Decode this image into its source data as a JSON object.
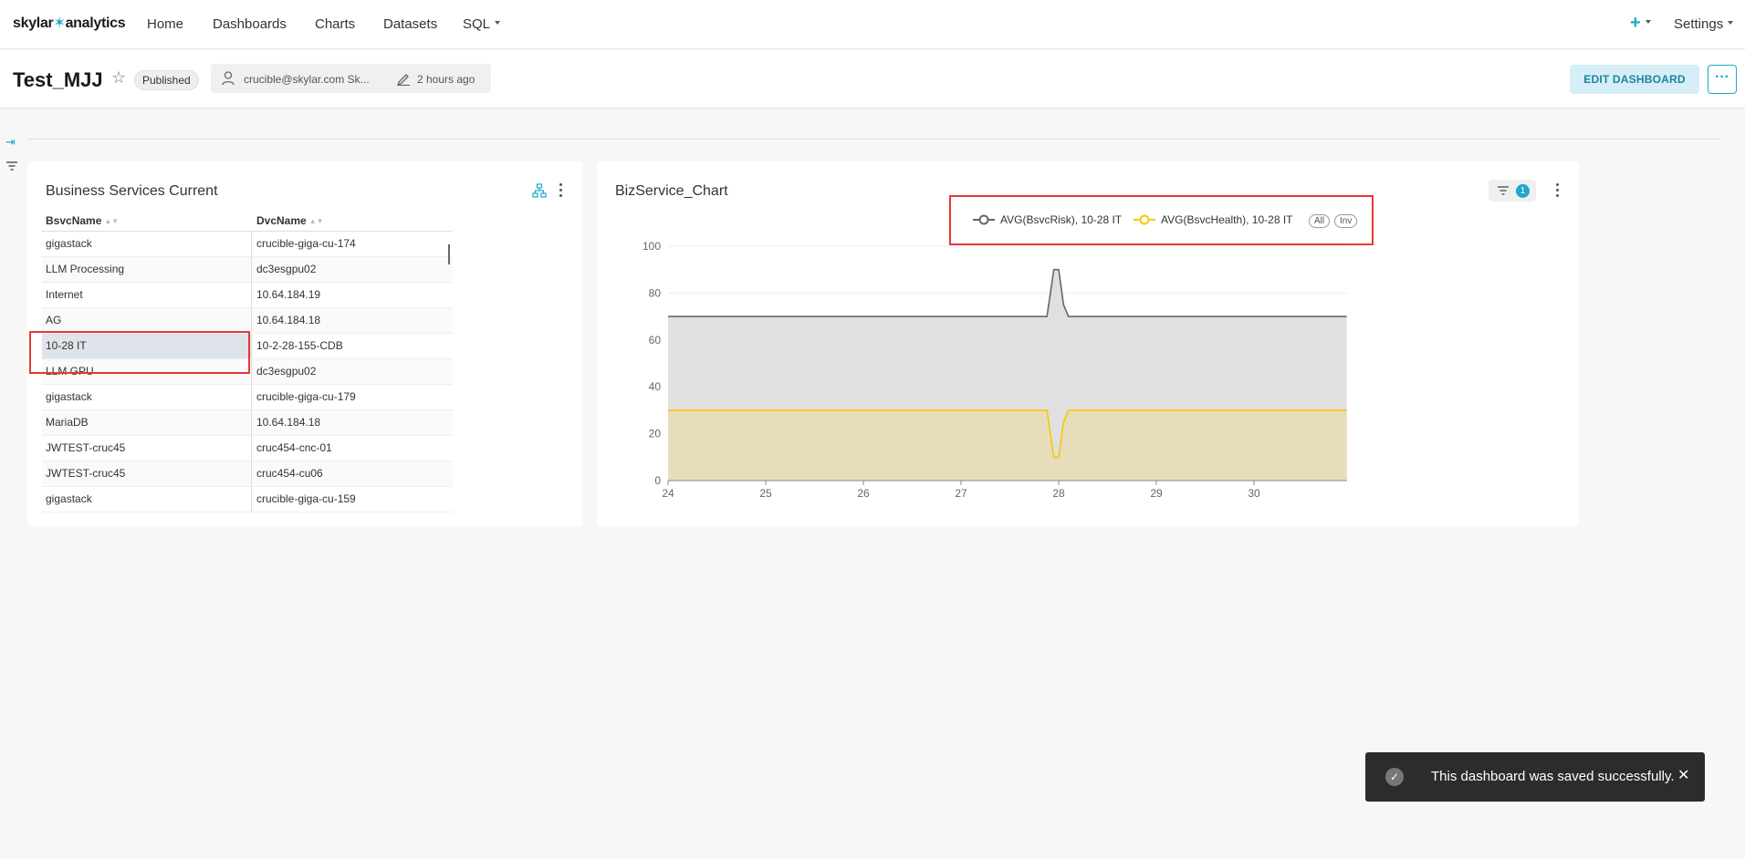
{
  "nav": {
    "logo_prefix": "skylar",
    "logo_mark": "✶",
    "logo_suffix": "analytics",
    "items": [
      "Home",
      "Dashboards",
      "Charts",
      "Datasets",
      "SQL"
    ],
    "plus": "+",
    "settings": "Settings"
  },
  "header": {
    "title": "Test_MJJ",
    "status": "Published",
    "owner": "crucible@skylar.com Sk...",
    "modified": "2 hours ago",
    "edit_label": "EDIT DASHBOARD",
    "more_label": "···"
  },
  "table_card": {
    "title": "Business Services Current",
    "columns": [
      "BsvcName",
      "DvcName"
    ],
    "rows": [
      [
        "gigastack",
        "crucible-giga-cu-174"
      ],
      [
        "LLM Processing",
        "dc3esgpu02"
      ],
      [
        "Internet",
        "10.64.184.19"
      ],
      [
        "AG",
        "10.64.184.18"
      ],
      [
        "10-28 IT",
        "10-2-28-155-CDB"
      ],
      [
        "LLM GPU",
        "dc3esgpu02"
      ],
      [
        "gigastack",
        "crucible-giga-cu-179"
      ],
      [
        "MariaDB",
        "10.64.184.18"
      ],
      [
        "JWTEST-cruc45",
        "cruc454-cnc-01"
      ],
      [
        "JWTEST-cruc45",
        "cruc454-cu06"
      ],
      [
        "gigastack",
        "crucible-giga-cu-159"
      ]
    ]
  },
  "chart_card": {
    "title": "BizService_Chart",
    "filter_count": "1",
    "legend_all": "All",
    "legend_inv": "Inv"
  },
  "chart_data": {
    "type": "area",
    "x": [
      24,
      25,
      26,
      27,
      27.88,
      27.95,
      28.0,
      28.05,
      28.1,
      29,
      30,
      30.95
    ],
    "x_ticks": [
      "24",
      "25",
      "26",
      "27",
      "28",
      "29",
      "30"
    ],
    "ylim": [
      0,
      100
    ],
    "y_ticks": [
      "0",
      "20",
      "40",
      "60",
      "80",
      "100"
    ],
    "series": [
      {
        "name": "AVG(BsvcRisk), 10-28 IT",
        "color": "#666666",
        "fill": "#e0e0e0",
        "values": [
          70,
          70,
          70,
          70,
          70,
          90,
          90,
          75,
          70,
          70,
          70,
          70
        ]
      },
      {
        "name": "AVG(BsvcHealth), 10-28 IT",
        "color": "#fcc700",
        "fill": "#e6dcb4",
        "values": [
          30,
          30,
          30,
          30,
          30,
          10,
          10,
          25,
          30,
          30,
          30,
          30
        ]
      }
    ]
  },
  "toast": {
    "message": "This dashboard was saved successfully.",
    "icon": "✓",
    "close": "✕"
  }
}
